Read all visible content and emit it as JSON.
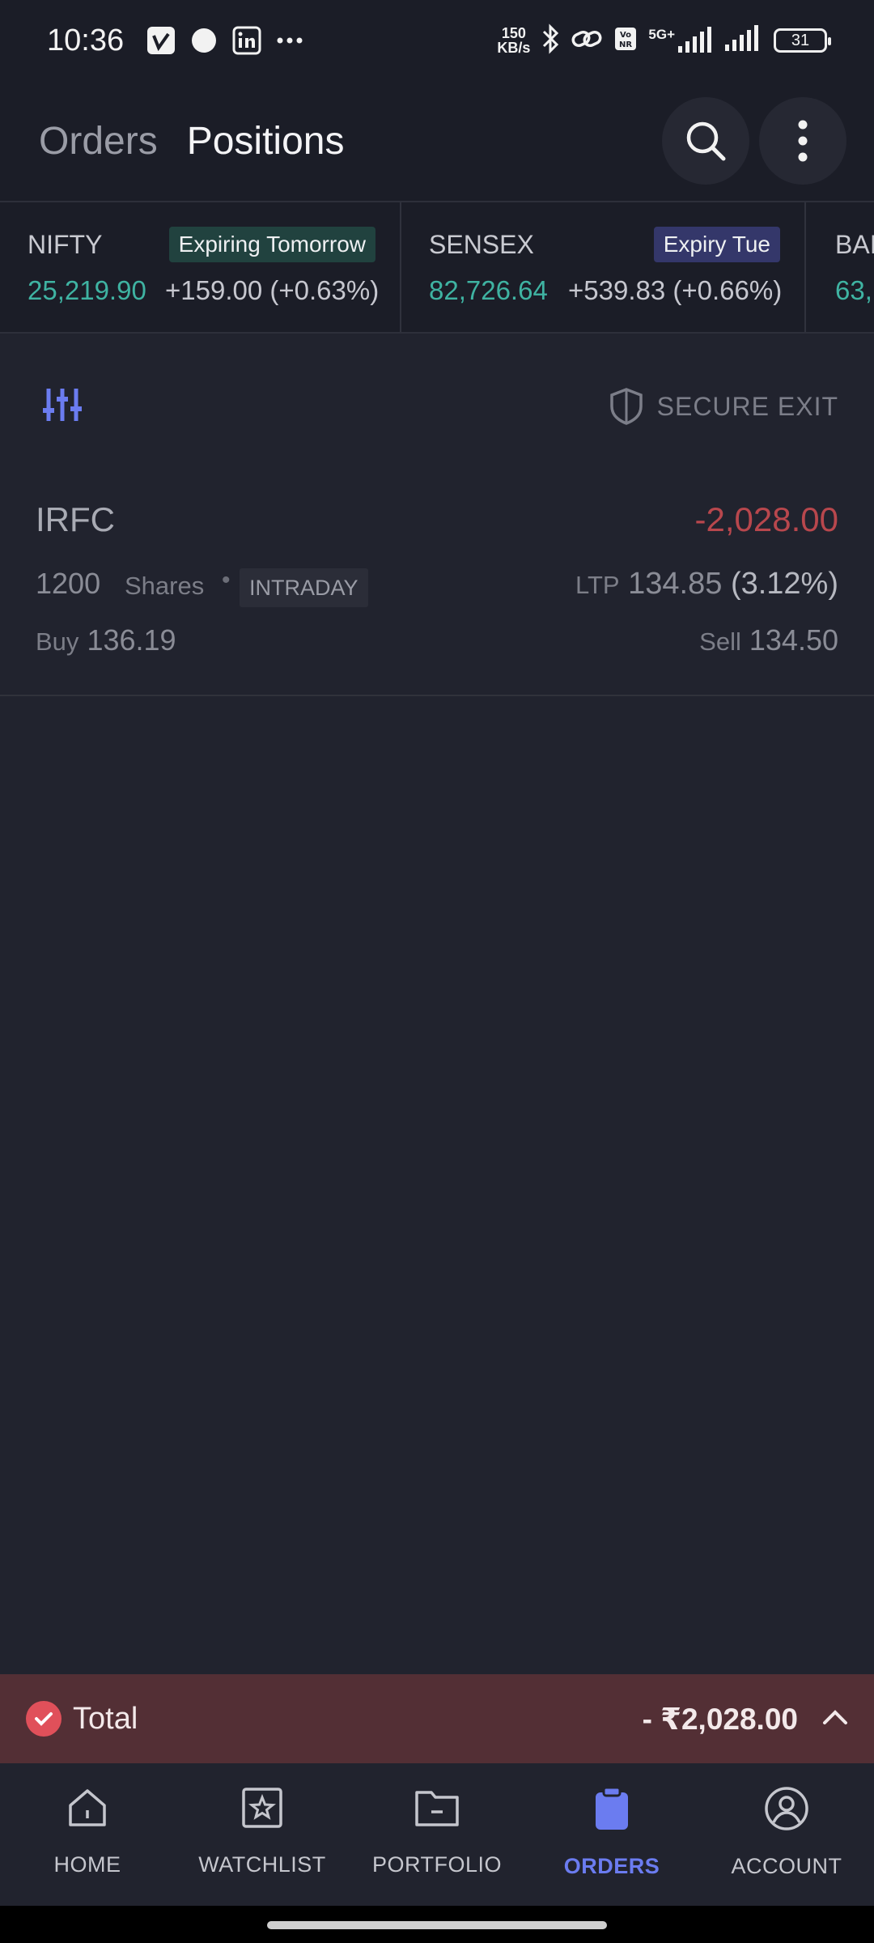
{
  "status_bar": {
    "time": "10:36",
    "net_speed_value": "150",
    "net_speed_unit": "KB/s",
    "network_label": "5G+",
    "volte_label": "Vo NR",
    "battery": "31"
  },
  "header": {
    "tabs": [
      {
        "label": "Orders",
        "active": false
      },
      {
        "label": "Positions",
        "active": true
      }
    ]
  },
  "tickers": [
    {
      "name": "NIFTY",
      "badge": "Expiring Tomorrow",
      "value": "25,219.90",
      "change": "+159.00 (+0.63%)"
    },
    {
      "name": "SENSEX",
      "badge": "Expiry Tue",
      "value": "82,726.64",
      "change": "+539.83 (+0.66%)"
    },
    {
      "name": "BAI",
      "value": "63,"
    }
  ],
  "toolbar": {
    "secure_exit_label": "SECURE EXIT"
  },
  "positions": [
    {
      "symbol": "IRFC",
      "pnl": "-2,028.00",
      "qty": "1200",
      "qty_label": "Shares",
      "product": "INTRADAY",
      "ltp_label": "LTP",
      "ltp": "134.85",
      "ltp_change": "(3.12%)",
      "buy_label": "Buy",
      "buy_price": "136.19",
      "sell_label": "Sell",
      "sell_price": "134.50"
    }
  ],
  "total": {
    "label": "Total",
    "value": "- ₹2,028.00"
  },
  "bottom_nav": [
    {
      "label": "HOME",
      "icon": "home-icon",
      "active": false
    },
    {
      "label": "WATCHLIST",
      "icon": "watchlist-icon",
      "active": false
    },
    {
      "label": "PORTFOLIO",
      "icon": "portfolio-icon",
      "active": false
    },
    {
      "label": "ORDERS",
      "icon": "orders-icon",
      "active": true
    },
    {
      "label": "ACCOUNT",
      "icon": "account-icon",
      "active": false
    }
  ],
  "colors": {
    "background": "#21232e",
    "accent": "#6b7cf0",
    "profit_green": "#3fb3a2",
    "loss_red": "#b8474d",
    "total_bar": "#532f35"
  }
}
